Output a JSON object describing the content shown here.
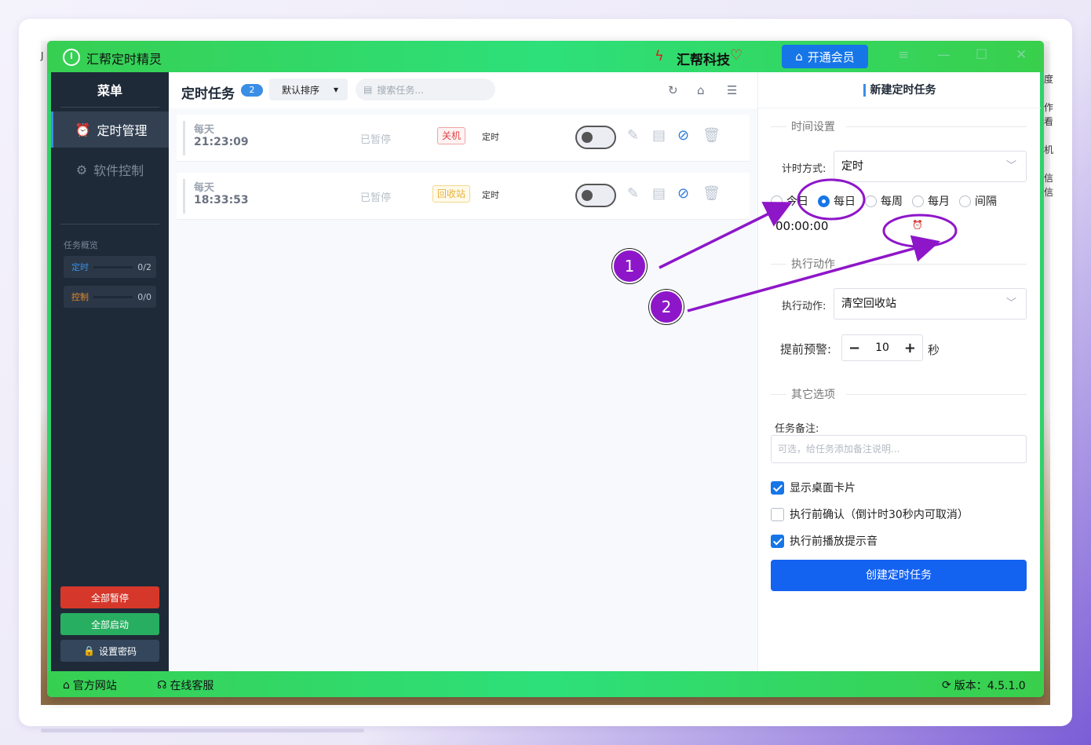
{
  "desktop": {
    "edge_left": "J",
    "edge_right": [
      "度",
      "作",
      "看",
      "机",
      "信",
      "信"
    ]
  },
  "titlebar": {
    "app_name": "汇帮定时精灵",
    "brand": "汇帮科技",
    "vip_label": "开通会员",
    "controls": [
      "≡",
      "—",
      "☐",
      "✕"
    ]
  },
  "sidebar": {
    "title": "菜单",
    "items": [
      {
        "label": "定时管理",
        "icon": "alarm-clock-icon",
        "active": true
      },
      {
        "label": "软件控制",
        "icon": "gear-icon",
        "active": false
      }
    ],
    "overview_title": "任务概览",
    "stats": [
      {
        "label": "定时",
        "value": "0/2",
        "color": "#3a8ee6"
      },
      {
        "label": "控制",
        "value": "0/0",
        "color": "#e08a2c"
      }
    ],
    "buttons": {
      "pause_all": "全部暂停",
      "start_all": "全部启动",
      "set_password": "设置密码"
    }
  },
  "tasks": {
    "title": "定时任务",
    "count": "2",
    "sort_label": "默认排序",
    "search_placeholder": "搜索任务...",
    "rows": [
      {
        "frequency": "每天",
        "time": "21:23:09",
        "status": "已暂停",
        "action_tag": "关机",
        "tag_color": "red",
        "type": "定时",
        "enabled": false
      },
      {
        "frequency": "每天",
        "time": "18:33:53",
        "status": "已暂停",
        "action_tag": "回收站",
        "tag_color": "yellow",
        "type": "定时",
        "enabled": false
      }
    ]
  },
  "form": {
    "title": "新建定时任务",
    "time_section": "时间设置",
    "timing_mode_label": "计时方式:",
    "timing_mode_value": "定时",
    "frequency_options": [
      "今日",
      "每日",
      "每周",
      "每月",
      "间隔"
    ],
    "frequency_selected": "每日",
    "time_value": "00:00:00",
    "action_section": "执行动作",
    "action_label": "执行动作:",
    "action_value": "清空回收站",
    "warn_label": "提前预警:",
    "warn_value": "10",
    "warn_unit": "秒",
    "other_section": "其它选项",
    "memo_label": "任务备注:",
    "memo_placeholder": "可选，给任务添加备注说明...",
    "options": [
      {
        "label": "显示桌面卡片",
        "checked": true
      },
      {
        "label": "执行前确认（倒计时30秒内可取消）",
        "checked": false
      },
      {
        "label": "执行前播放提示音",
        "checked": true
      }
    ],
    "submit_label": "创建定时任务"
  },
  "footer": {
    "website": "官方网站",
    "support": "在线客服",
    "version": "版本：4.5.1.0"
  },
  "annotations": {
    "markers": [
      "1",
      "2"
    ],
    "color": "#8e16c9"
  }
}
